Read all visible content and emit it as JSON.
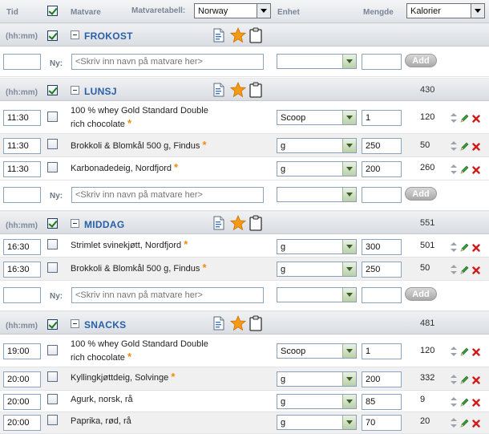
{
  "header": {
    "tid": "Tid",
    "matvare": "Matvare",
    "matvaretabell_label": "Matvaretabell:",
    "matvaretabell_value": "Norway",
    "enhet": "Enhet",
    "mengde": "Mengde",
    "metric_value": "Kalorier"
  },
  "common": {
    "hhmm": "(hh:mm)",
    "ny": "Ny:",
    "name_placeholder": "<Skriv inn navn på matvare her>",
    "add": "Add",
    "asterisk": "*"
  },
  "meals": [
    {
      "name": "FROKOST",
      "kcal": ""
    },
    {
      "name": "LUNSJ",
      "kcal": "430"
    },
    {
      "name": "MIDDAG",
      "kcal": "551"
    },
    {
      "name": "SNACKS",
      "kcal": "481"
    }
  ],
  "lunsj_items": [
    {
      "time": "11:30",
      "name": "100 % whey Gold Standard Double rich chocolate",
      "unit": "Scoop",
      "amount": "1",
      "kcal": "120"
    },
    {
      "time": "11:30",
      "name": "Brokkoli & Blomkål 500 g, Findus",
      "unit": "g",
      "amount": "250",
      "kcal": "50"
    },
    {
      "time": "11:30",
      "name": "Karbonadedeig, Nordfjord",
      "unit": "g",
      "amount": "200",
      "kcal": "260"
    }
  ],
  "middag_items": [
    {
      "time": "16:30",
      "name": "Strimlet svinekjøtt, Nordfjord",
      "unit": "g",
      "amount": "300",
      "kcal": "501"
    },
    {
      "time": "16:30",
      "name": "Brokkoli & Blomkål 500 g, Findus",
      "unit": "g",
      "amount": "250",
      "kcal": "50"
    }
  ],
  "snacks_items": [
    {
      "time": "19:00",
      "name": "100 % whey Gold Standard Double rich chocolate",
      "unit": "Scoop",
      "amount": "1",
      "kcal": "120"
    },
    {
      "time": "20:00",
      "name": "Kyllingkjøttdeig, Solvinge",
      "unit": "g",
      "amount": "200",
      "kcal": "332"
    },
    {
      "time": "20:00",
      "name": "Agurk, norsk, rå",
      "unit": "g",
      "amount": "85",
      "kcal": "9"
    },
    {
      "time": "20:00",
      "name": "Paprika, rød, rå",
      "unit": "g",
      "amount": "70",
      "kcal": "20"
    }
  ],
  "colors": {
    "meal_title": "#2860a8",
    "asterisk": "#f08a0c",
    "delete": "#d11a1a",
    "edit": "#2e8b2e"
  },
  "icons": [
    "copy-list-icon",
    "favorite-star-icon",
    "clipboard-icon",
    "move-up-down-icon",
    "edit-pencil-icon",
    "delete-icon",
    "collapse-minus-icon"
  ]
}
